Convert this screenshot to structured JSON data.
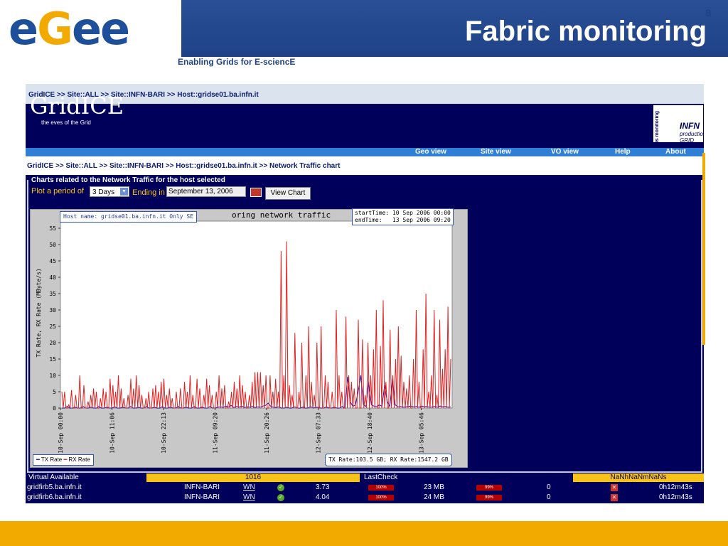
{
  "slide": {
    "logo": {
      "part1": "e",
      "part2": "G",
      "part3": "ee"
    },
    "title": "Fabric monitoring",
    "subtitle": "Enabling Grids for E-sciencE",
    "page_number": "8",
    "colors": {
      "band": "#1f4287",
      "accent": "#f2a900"
    }
  },
  "app": {
    "breadcrumb_top": "GridICE >> Site::ALL >> Site::INFN-BARI >> Host::gridse01.ba.infn.it",
    "logo": "GridICE",
    "tagline": "the eves of the Grid",
    "infn": {
      "vertical_label": "is monitoring",
      "name": "INFN",
      "sub1": "production",
      "sub2": "GRID"
    },
    "nav": [
      "Geo view",
      "Site view",
      "VO view",
      "Help",
      "About"
    ],
    "breadcrumb": "GridICE >> Site::ALL >> Site::INFN-BARI >> Host::gridse01.ba.infn.it >> Network Traffic chart",
    "section_legend": "Charts related to the Network Traffic for the host selected",
    "controls": {
      "plot_label": "Plot a period of",
      "period_value": "3 Days",
      "ending_label": "Ending in",
      "date_value": "September 13, 2006",
      "button": "View Chart"
    },
    "virtual_row": {
      "label": "Virtual Available",
      "value": "1016",
      "lastcheck_label": "LastCheck",
      "lastcheck_value": "NaNhNaNmNaNs"
    },
    "rows": [
      {
        "host": "gridfirb5.ba.infn.it",
        "site": "INFN-BARI",
        "type": "WN",
        "load": "3.73",
        "p1": "100%",
        "mem": "23 MB",
        "p2": "99%",
        "jobs": "0",
        "age": "0h12m43s"
      },
      {
        "host": "gridfirb6.ba.infn.it",
        "site": "INFN-BARI",
        "type": "WN",
        "load": "4.04",
        "p1": "100%",
        "mem": "24 MB",
        "p2": "99%",
        "jobs": "0",
        "age": "0h12m43s"
      }
    ]
  },
  "chart_data": {
    "type": "line",
    "title": "Monitoring network traffic",
    "host_label": "Host name: gridse01.ba.infn.it Only SE",
    "start_time": "startTime: 10 Sep 2006 00:00",
    "end_time": "endTime:   13 Sep 2006 09:20",
    "summary": "TX Rate:103.5 GB; RX Rate:1547.2 GB",
    "ylabel": "TX Rate, RX Rate (MByte/s)",
    "ylim": [
      0,
      55
    ],
    "yticks": [
      0,
      5,
      10,
      15,
      20,
      25,
      30,
      35,
      40,
      45,
      50,
      55
    ],
    "xticks": [
      "10-Sep 00:00",
      "10-Sep 11:06",
      "10-Sep 22:13",
      "11-Sep 09:20",
      "11-Sep 20:26",
      "12-Sep 07:33",
      "12-Sep 18:40",
      "13-Sep 05:46"
    ],
    "series": [
      {
        "name": "TX Rate",
        "color": "#1010c0",
        "values": [
          0,
          0,
          0.5,
          0,
          0,
          0.3,
          0,
          0,
          0.5,
          0,
          0,
          0.3,
          0,
          0,
          0.5,
          0,
          0,
          0.3,
          0,
          0,
          0.4,
          0,
          0,
          0.3,
          0,
          0,
          0.5,
          0,
          0,
          0.3,
          0,
          0,
          0.5,
          0,
          0,
          0.3,
          0,
          0,
          0.5,
          0,
          0,
          0.3,
          0,
          0,
          0.5,
          0,
          0,
          0.3,
          0,
          0,
          0.5,
          0,
          0,
          0.3,
          0,
          0,
          0.5,
          0,
          0,
          0.3,
          0.4,
          0.2,
          0.6,
          0.3,
          0.8,
          0.2,
          0.5,
          0.3,
          0.6,
          0.2,
          0.4,
          0.3,
          0.5,
          0.2,
          0.4,
          0.3,
          0.6,
          0.8,
          1.5,
          0.5,
          0.3,
          0.2,
          0.4,
          0,
          0,
          0.3,
          0,
          0,
          0.4,
          0,
          0,
          0.3,
          0,
          0,
          0.5,
          0,
          0.3,
          0.2,
          0,
          0,
          0.4,
          0,
          0,
          0.3,
          0,
          0,
          0.5,
          0,
          9.5,
          2,
          0.5,
          1,
          5,
          10,
          1,
          0.5,
          8,
          1,
          0.6,
          0.4,
          1,
          0.5,
          7,
          2,
          0.5,
          9,
          1,
          0.4,
          0.5,
          0.3,
          0.4,
          0.5,
          0.6,
          0.4,
          0.5,
          0.3,
          0.6,
          0.4,
          0.5,
          0.3,
          0.4,
          0.5,
          0.3,
          0.6,
          0.4,
          0.5,
          0.3,
          0.4
        ]
      },
      {
        "name": "RX Rate",
        "color": "#e02020",
        "values": [
          5,
          0,
          5,
          0,
          0,
          1,
          0,
          5.5,
          0,
          0,
          4,
          0,
          0,
          10,
          0,
          0,
          7,
          0,
          0,
          2,
          0,
          4,
          0,
          6,
          0,
          5,
          0,
          0,
          3,
          0,
          6,
          0,
          5,
          0,
          0,
          9,
          0,
          7,
          0,
          5,
          0,
          10,
          0,
          6,
          0,
          3,
          0,
          0,
          4,
          0,
          9,
          0,
          6,
          0,
          10,
          0,
          7,
          0,
          4,
          0,
          0,
          3,
          0,
          5,
          0,
          0,
          6,
          0,
          7,
          0,
          5,
          0,
          8,
          0,
          9,
          0,
          4,
          0,
          6,
          0,
          3,
          0,
          0,
          5,
          0,
          0,
          6,
          0,
          0,
          8,
          0,
          5,
          0,
          10,
          0,
          4,
          0,
          0,
          9,
          0,
          6,
          0,
          0,
          4,
          0,
          9,
          0,
          7,
          0,
          4,
          0,
          0,
          5,
          0,
          10,
          0,
          6,
          0,
          7,
          0,
          0,
          2,
          0,
          5,
          0,
          8,
          0,
          6,
          0,
          10,
          0,
          7,
          0,
          5,
          0,
          0,
          4,
          0,
          8,
          0,
          11,
          0,
          11,
          0,
          11,
          0,
          7,
          0,
          10,
          0,
          0,
          10,
          0,
          5,
          0,
          9,
          0,
          5,
          0,
          48,
          0,
          10,
          0,
          51,
          0,
          7,
          0,
          4,
          0,
          23,
          0,
          0,
          5,
          0,
          20,
          0,
          0,
          10,
          0,
          25,
          0,
          8,
          0,
          4,
          0,
          20,
          0,
          0,
          25,
          0,
          0,
          10,
          0,
          8,
          0,
          0,
          5,
          0,
          0,
          30,
          0,
          10,
          0,
          5,
          0,
          0,
          28,
          0,
          10,
          0,
          8,
          0,
          6,
          0,
          0,
          27,
          0,
          0,
          21,
          0,
          4,
          0,
          20,
          0,
          10,
          0,
          18,
          0,
          30,
          0,
          0,
          19,
          0,
          33,
          0,
          8,
          0,
          0,
          24,
          0,
          10,
          0,
          15,
          0,
          25,
          0,
          16,
          0,
          8,
          0,
          6,
          0,
          10,
          0,
          0,
          15,
          0,
          30,
          0,
          8,
          0,
          0,
          18,
          0,
          35,
          0,
          5,
          0,
          10,
          0,
          30,
          0,
          4,
          0,
          27,
          0,
          12,
          0,
          18,
          0,
          31,
          0,
          15
        ]
      }
    ],
    "legend": [
      "TX Rate",
      "RX Rate"
    ]
  }
}
